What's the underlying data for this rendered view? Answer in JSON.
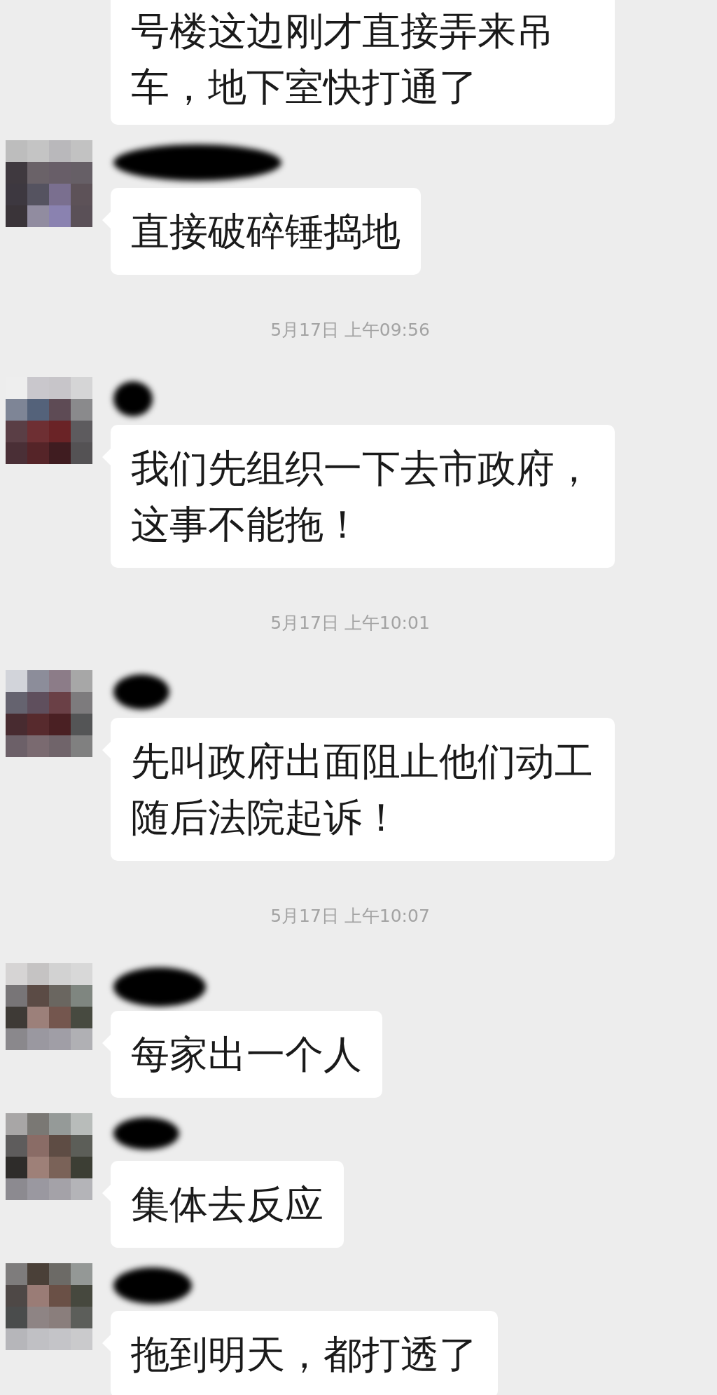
{
  "messages": [
    {
      "kind": "cut_message",
      "text": "号楼这边刚才直接弄来吊车，地下室快打通了"
    },
    {
      "kind": "message",
      "text": "直接破碎锤捣地"
    },
    {
      "kind": "timestamp",
      "text": "5月17日 上午09:56"
    },
    {
      "kind": "message",
      "text": "我们先组织一下去市政府，这事不能拖！"
    },
    {
      "kind": "timestamp",
      "text": "5月17日 上午10:01"
    },
    {
      "kind": "message",
      "text": "先叫政府出面阻止他们动工随后法院起诉！"
    },
    {
      "kind": "timestamp",
      "text": "5月17日 上午10:07"
    },
    {
      "kind": "message",
      "text": "每家出一个人"
    },
    {
      "kind": "message",
      "text": "集体去反应"
    },
    {
      "kind": "message",
      "text": "拖到明天，都打透了"
    }
  ]
}
